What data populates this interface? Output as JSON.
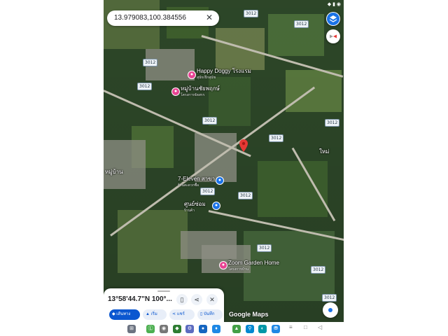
{
  "colors": {
    "accent": "#0b57d0",
    "pin": "#e53935",
    "poi_pink": "#e84393",
    "poi_blue": "#1a73e8"
  },
  "search": {
    "query": "13.979083,100.384556",
    "close_icon": "close-icon"
  },
  "status": {
    "icons": "◆ ▮ ◉"
  },
  "map": {
    "road_shields": [
      "3012",
      "3012",
      "3012",
      "3012",
      "3012",
      "3012",
      "3012",
      "3012",
      "3012",
      "3012",
      "3012",
      "3012"
    ],
    "labels": [
      {
        "name": "Happy Doggy โรงแรม",
        "sub": "สุนัข ฝึกสุนัข"
      },
      {
        "name": "หมู่บ้านชัยพฤกษ์",
        "sub": "โครงการจัดสรร"
      },
      {
        "name": "7-Eleven สาขา",
        "sub": "ร้านสะดวกซื้อ"
      },
      {
        "name": "ศูนย์ซ่อม",
        "sub": "ร้านค้า"
      },
      {
        "name": "Zoom Garden Home",
        "sub": "โครงการบ้าน"
      }
    ],
    "small_labels": [
      "หมู่บ้าน",
      "ใหม่"
    ]
  },
  "sheet": {
    "coordinates": "13°58'44.7\"N 100°...",
    "icons": [
      "bookmark-icon",
      "share-icon",
      "close-icon"
    ],
    "chips": [
      "เส้นทาง",
      "เริ่ม",
      "แชร์",
      "บันทึก"
    ]
  },
  "attribution": "Google Maps",
  "nav_bar": {
    "apps": [
      "⊞",
      "Ⓛ",
      "◉",
      "◆",
      "⚙",
      "●",
      "♦",
      "▲",
      "⚲",
      "◐",
      "⛃"
    ],
    "buttons": [
      "≡",
      "□",
      "◁"
    ]
  }
}
